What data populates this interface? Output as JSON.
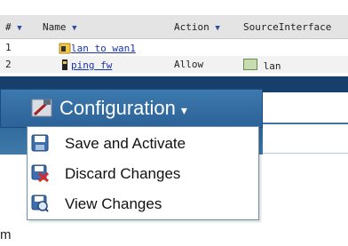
{
  "table": {
    "columns": [
      {
        "label": "#",
        "arrow": "▼"
      },
      {
        "label": "Name",
        "arrow": "▼"
      },
      {
        "label": "Action",
        "arrow": "▼"
      },
      {
        "label": "SourceInterface",
        "arrow": ""
      }
    ],
    "rows": [
      {
        "num": "1",
        "name": "lan to wan1",
        "action": "",
        "source": ""
      },
      {
        "num": "2",
        "name": "ping fw",
        "action": "Allow",
        "source": "lan"
      }
    ]
  },
  "menu": {
    "title": "Configuration",
    "chevron": "▾",
    "items": [
      {
        "label": "Save and Activate",
        "icon": "save-icon"
      },
      {
        "label": "Discard Changes",
        "icon": "discard-icon"
      },
      {
        "label": "View Changes",
        "icon": "view-changes-icon"
      }
    ]
  },
  "footer_fragment": "m",
  "colors": {
    "band": "#163f6c",
    "tab": "#3d79ae",
    "link": "#1a35a8"
  }
}
